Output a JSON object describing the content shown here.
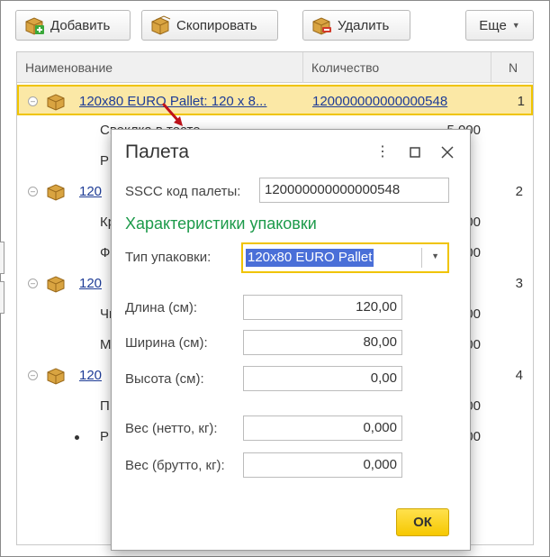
{
  "toolbar": {
    "add_label": "Добавить",
    "copy_label": "Скопировать",
    "delete_label": "Удалить",
    "more_label": "Еще"
  },
  "table": {
    "headers": {
      "name": "Наименование",
      "quantity": "Количество",
      "n": "N"
    },
    "rows": [
      {
        "name": "120x80 EURO Pallet:   120 x 8...",
        "quantity": "120000000000000548",
        "n": "1"
      },
      {
        "name": "Свеклка в тесте",
        "quantity": "5,000"
      },
      {
        "name": "Р"
      },
      {
        "name": "120",
        "n": "2"
      },
      {
        "name": "Кр",
        "quantity": "000"
      },
      {
        "name": "Ф",
        "quantity": "000"
      },
      {
        "name": "120",
        "n": "3"
      },
      {
        "name": "Чи",
        "quantity": "000"
      },
      {
        "name": "М",
        "quantity": "000"
      },
      {
        "name": "120",
        "n": "4"
      },
      {
        "name": "П",
        "quantity": "000"
      },
      {
        "name": "Р",
        "quantity": "000"
      }
    ]
  },
  "dialog": {
    "title": "Палета",
    "sscc_label": "SSCC код палеты:",
    "sscc_value": "120000000000000548",
    "section_title": "Характеристики упаковки",
    "pack_type_label": "Тип упаковки:",
    "pack_type_value": "120x80 EURO Pallet",
    "length_label": "Длина (см):",
    "length_value": "120,00",
    "width_label": "Ширина (см):",
    "width_value": "80,00",
    "height_label": "Высота (см):",
    "height_value": "0,00",
    "net_label": "Вес (нетто, кг):",
    "net_value": "0,000",
    "gross_label": "Вес (брутто, кг):",
    "gross_value": "0,000",
    "ok_label": "ОК"
  },
  "colors": {
    "accent_yellow": "#f0c400",
    "section_green": "#1c9a4a",
    "link_blue": "#1e3c96",
    "selection_bg": "#fbe8a6",
    "arrow_red": "#c0121a"
  },
  "icons": [
    "add-package-icon",
    "copy-package-icon",
    "delete-package-icon",
    "package-icon",
    "collapse-icon",
    "more-dots-icon",
    "maximize-icon",
    "close-icon",
    "dropdown-arrow-icon"
  ]
}
